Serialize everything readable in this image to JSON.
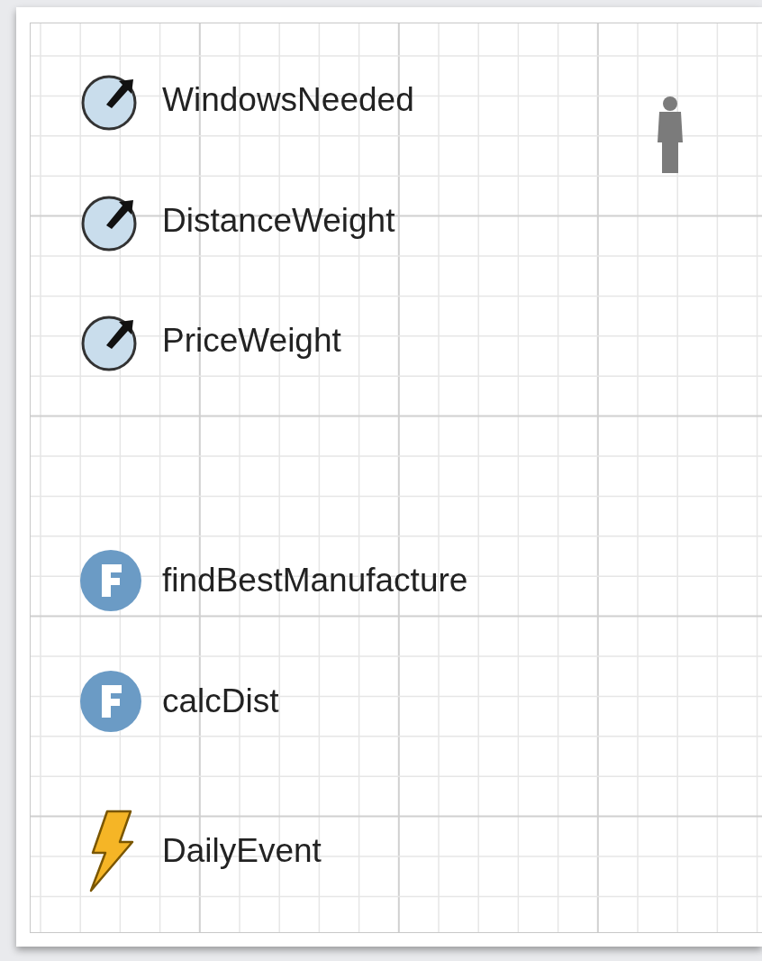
{
  "canvas": {
    "elements": [
      {
        "kind": "variable",
        "label": "WindowsNeeded"
      },
      {
        "kind": "variable",
        "label": "DistanceWeight"
      },
      {
        "kind": "variable",
        "label": "PriceWeight"
      },
      {
        "kind": "function",
        "label": "findBestManufacture"
      },
      {
        "kind": "function",
        "label": "calcDist"
      },
      {
        "kind": "event",
        "label": "DailyEvent"
      }
    ],
    "agent": {
      "kind": "person"
    }
  }
}
